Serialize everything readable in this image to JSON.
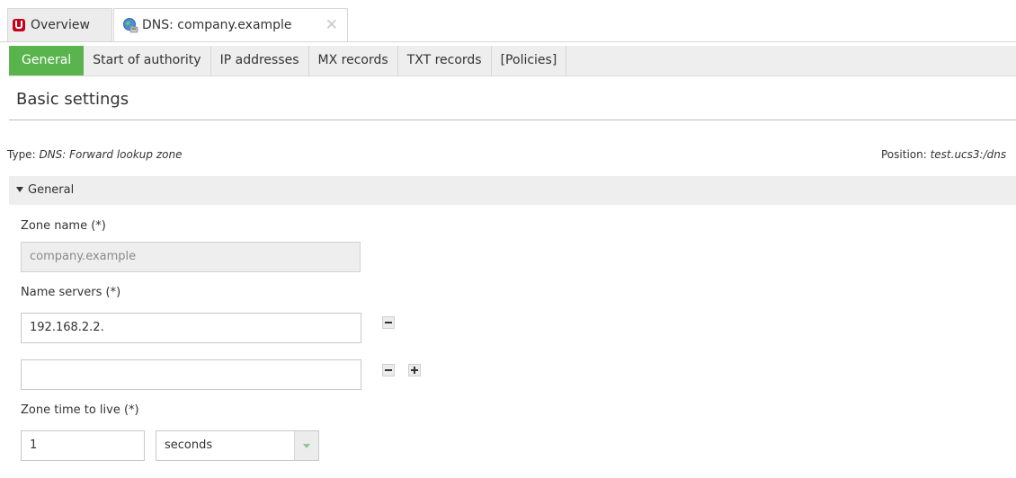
{
  "top_tabs": [
    {
      "label": "Overview",
      "icon": "univention-logo-icon"
    },
    {
      "label": "DNS: company.example",
      "icon": "dns-globe-icon",
      "close": "✕"
    }
  ],
  "sub_tabs": [
    "General",
    "Start of authority",
    "IP addresses",
    "MX records",
    "TXT records",
    "[Policies]"
  ],
  "section_title": "Basic settings",
  "meta": {
    "type_label": "Type:",
    "type_value": "DNS: Forward lookup zone",
    "position_label": "Position:",
    "position_value": "test.ucs3:/dns"
  },
  "group": {
    "title": "General"
  },
  "fields": {
    "zone_name_label": "Zone name (*)",
    "zone_name_value": "company.example",
    "name_servers_label": "Name servers (*)",
    "name_servers": [
      "192.168.2.2.",
      ""
    ],
    "ttl_label": "Zone time to live (*)",
    "ttl_value": "1",
    "ttl_unit": "seconds"
  },
  "colors": {
    "accent": "#5ab44d",
    "logo": "#c5001a"
  }
}
